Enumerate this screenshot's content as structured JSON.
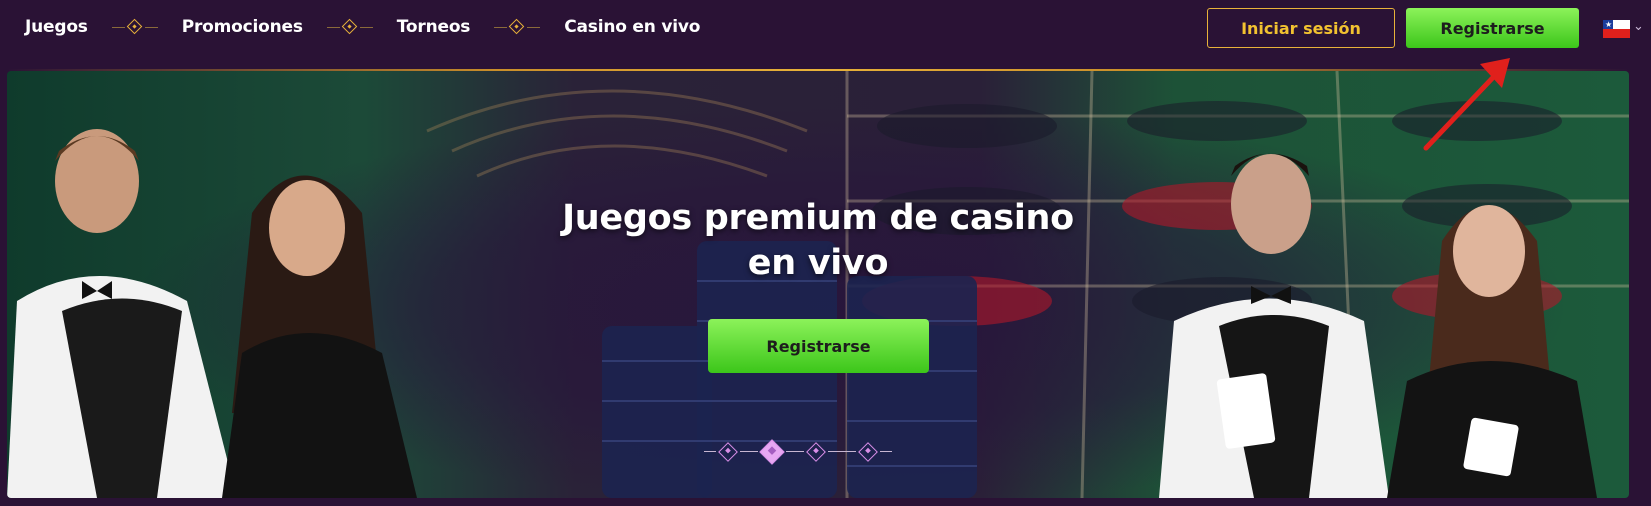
{
  "nav": {
    "items": [
      {
        "label": "Juegos"
      },
      {
        "label": "Promociones"
      },
      {
        "label": "Torneos"
      },
      {
        "label": "Casino en vivo"
      }
    ]
  },
  "header": {
    "login_label": "Iniciar sesión",
    "register_label": "Registrarse",
    "language_icon": "chile-flag-icon",
    "language_chevron_icon": "chevron-down-icon"
  },
  "hero": {
    "title_line1": "Juegos premium de casino",
    "title_line2": "en vivo",
    "register_label": "Registrarse",
    "slide_count": 4,
    "active_slide": 2
  },
  "colors": {
    "background": "#2a1235",
    "accent_gold": "#e8b23a",
    "cta_green": "#4fd424",
    "annotation_arrow": "#e0201c"
  }
}
